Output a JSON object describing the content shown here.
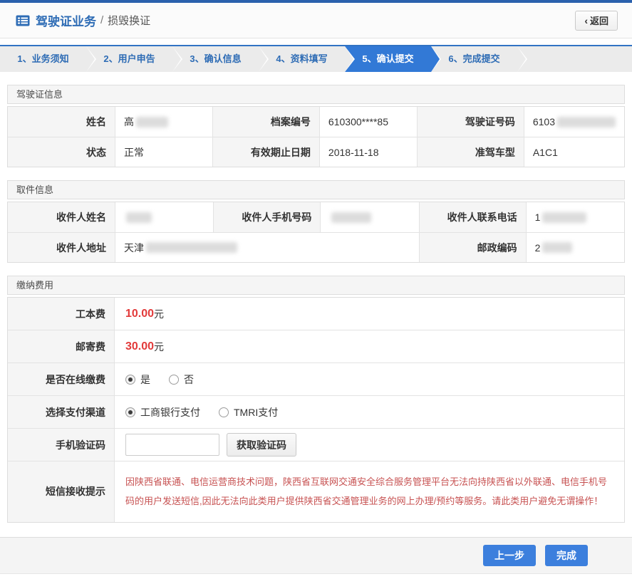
{
  "page": {
    "title": "驾驶证业务",
    "separator": "/",
    "subtitle": "损毁换证",
    "back_label": "返回",
    "back_chevron": "‹"
  },
  "colors": {
    "top_bar": "#2b61ad",
    "accent_blue": "#3279d6",
    "step_text_blue": "#2e6cb5",
    "fee_red": "#e23a3a",
    "notice_red": "#c75252",
    "button_blue": "#3c7fdd"
  },
  "steps": [
    {
      "label": "1、业务须知",
      "active": false
    },
    {
      "label": "2、用户申告",
      "active": false
    },
    {
      "label": "3、确认信息",
      "active": false
    },
    {
      "label": "4、资料填写",
      "active": false
    },
    {
      "label": "5、确认提交",
      "active": true
    },
    {
      "label": "6、完成提交",
      "active": false
    }
  ],
  "license_section": {
    "title": "驾驶证信息",
    "rows": [
      [
        {
          "label": "姓名",
          "value": "高",
          "blob": 45
        },
        {
          "label": "档案编号",
          "value": "610300****85"
        },
        {
          "label": "驾驶证号码",
          "value": "6103",
          "blob": 82
        }
      ],
      [
        {
          "label": "状态",
          "value": "正常"
        },
        {
          "label": "有效期止日期",
          "value": "2018-11-18"
        },
        {
          "label": "准驾车型",
          "value": "A1C1"
        }
      ]
    ]
  },
  "pickup_section": {
    "title": "取件信息",
    "rows": [
      [
        {
          "label": "收件人姓名",
          "value": "",
          "blob": 36
        },
        {
          "label": "收件人手机号码",
          "value": "",
          "blob": 56
        },
        {
          "label": "收件人联系电话",
          "value": "1",
          "blob": 62
        }
      ],
      [
        {
          "label": "收件人地址",
          "value": "天津",
          "blob": 128,
          "span": 3
        },
        {
          "label": "邮政编码",
          "value": "2",
          "blob": 42
        }
      ]
    ]
  },
  "payment_section": {
    "title": "缴纳费用",
    "fee_rows": [
      {
        "label": "工本费",
        "amount": "10.00",
        "unit": "元"
      },
      {
        "label": "邮寄费",
        "amount": "30.00",
        "unit": "元"
      }
    ],
    "online_pay": {
      "label": "是否在线缴费",
      "options": [
        "是",
        "否"
      ],
      "selected": 0
    },
    "channel": {
      "label": "选择支付渠道",
      "options": [
        "工商银行支付",
        "TMRI支付"
      ],
      "selected": 0
    },
    "sms_code": {
      "label": "手机验证码",
      "input_value": "",
      "button_label": "获取验证码"
    },
    "notice": {
      "label": "短信接收提示",
      "text": "因陕西省联通、电信运营商技术问题，陕西省互联网交通安全综合服务管理平台无法向持陕西省以外联通、电信手机号码的用户发送短信,因此无法向此类用户提供陕西省交通管理业务的网上办理/预约等服务。请此类用户避免无谓操作！"
    }
  },
  "footer": {
    "prev_label": "上一步",
    "finish_label": "完成"
  }
}
